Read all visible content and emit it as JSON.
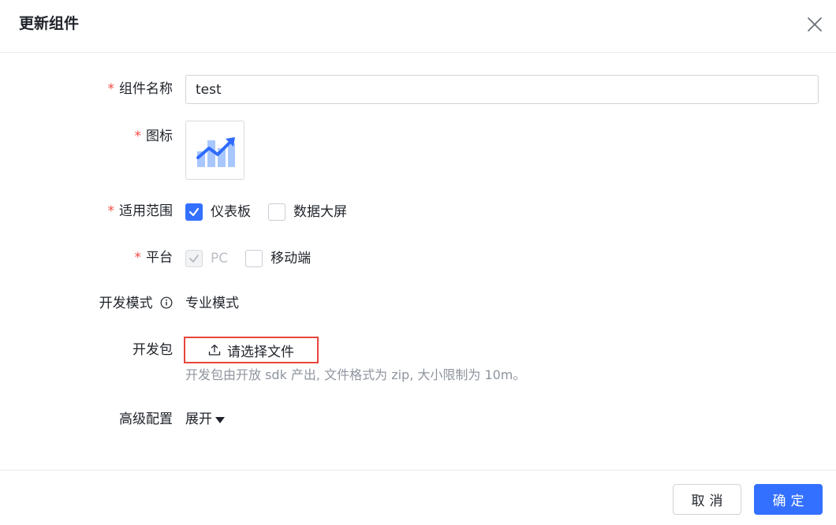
{
  "dialog": {
    "title": "更新组件",
    "close_icon": "close-icon"
  },
  "form": {
    "name": {
      "label": "组件名称",
      "required_mark": "*",
      "value": "test"
    },
    "icon": {
      "label": "图标",
      "required_mark": "*",
      "preview_icon": "rising-bar-chart-icon"
    },
    "scope": {
      "label": "适用范围",
      "required_mark": "*",
      "options": [
        {
          "label": "仪表板",
          "checked": true
        },
        {
          "label": "数据大屏",
          "checked": false
        }
      ]
    },
    "platform": {
      "label": "平台",
      "required_mark": "*",
      "options": [
        {
          "label": "PC",
          "checked": true,
          "disabled": true
        },
        {
          "label": "移动端",
          "checked": false
        }
      ]
    },
    "dev_mode": {
      "label": "开发模式",
      "info_icon": "info-icon",
      "value": "专业模式"
    },
    "package": {
      "label": "开发包",
      "button_label": "请选择文件",
      "upload_icon": "upload-icon",
      "hint": "开发包由开放 sdk 产出, 文件格式为 zip, 大小限制为 10m。"
    },
    "advanced": {
      "label": "高级配置",
      "toggle_label": "展开"
    }
  },
  "footer": {
    "cancel_label": "取消",
    "ok_label": "确定"
  },
  "colors": {
    "accent": "#3370ff",
    "required": "#f54a45",
    "highlight_border": "#e8453c"
  }
}
